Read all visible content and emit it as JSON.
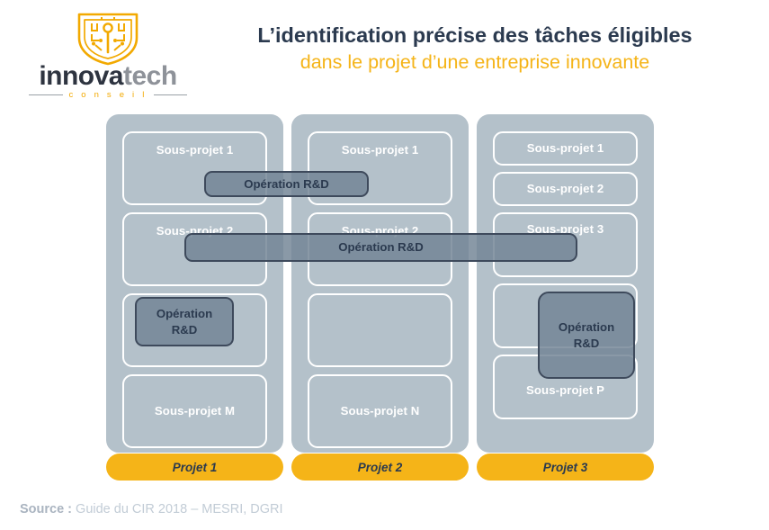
{
  "header": {
    "logo": {
      "icon": "shield-circuit-logo-icon",
      "wordmark_part1": "innova",
      "wordmark_part2": "tech",
      "tagline": "c o n s e i l"
    },
    "title_line1": "L’identification précise des tâches éligibles",
    "title_line2": "dans le projet d’une entreprise innovante"
  },
  "diagram": {
    "columns": [
      {
        "project_label": "Projet 1",
        "subprojects": [
          {
            "label": "Sous-projet 1"
          },
          {
            "label": "Sous-projet 2"
          },
          {
            "label": ""
          },
          {
            "label": "Sous-projet M"
          }
        ]
      },
      {
        "project_label": "Projet 2",
        "subprojects": [
          {
            "label": "Sous-projet 1"
          },
          {
            "label": "Sous-projet 2"
          },
          {
            "label": ""
          },
          {
            "label": "Sous-projet N"
          }
        ]
      },
      {
        "project_label": "Projet 3",
        "subprojects": [
          {
            "label": "Sous-projet 1"
          },
          {
            "label": "Sous-projet 2"
          },
          {
            "label": "Sous-projet 3"
          },
          {
            "label": ""
          },
          {
            "label": "Sous-projet  P"
          }
        ]
      }
    ],
    "operations": [
      {
        "id": "rd-bar-a",
        "label": "Opération  R&D",
        "spans": "Projet 1 Sous-projet 1 → Projet 2 Sous-projet 1"
      },
      {
        "id": "rd-bar-b",
        "label": "Opération  R&D",
        "spans": "Projet 1 Sous-projet 2 → Projet 2 Sous-projet 2 → Projet 3 Sous-projet 3"
      },
      {
        "id": "rd-box-c",
        "label": "Opération\nR&D",
        "line1": "Opération",
        "line2": "R&D",
        "spans": "Projet 1 slot 3"
      },
      {
        "id": "rd-box-d",
        "label": "Opération\nR&D",
        "line1": "Opération",
        "line2": "R&D",
        "spans": "Projet 3 slot 4 → slot 5"
      }
    ]
  },
  "footer": {
    "lead": "Source :",
    "text": "Guide du CIR 2018 – MESRI, DGRI"
  },
  "colors": {
    "accent_orange": "#F5B418",
    "logo_orange": "#F2A900",
    "panel_bg": "#b4c1ca",
    "title_navy": "#2b3a4f",
    "operation_fill": "#708294",
    "operation_border": "#3e4a5c",
    "footer_grey": "#c2ccd6"
  }
}
